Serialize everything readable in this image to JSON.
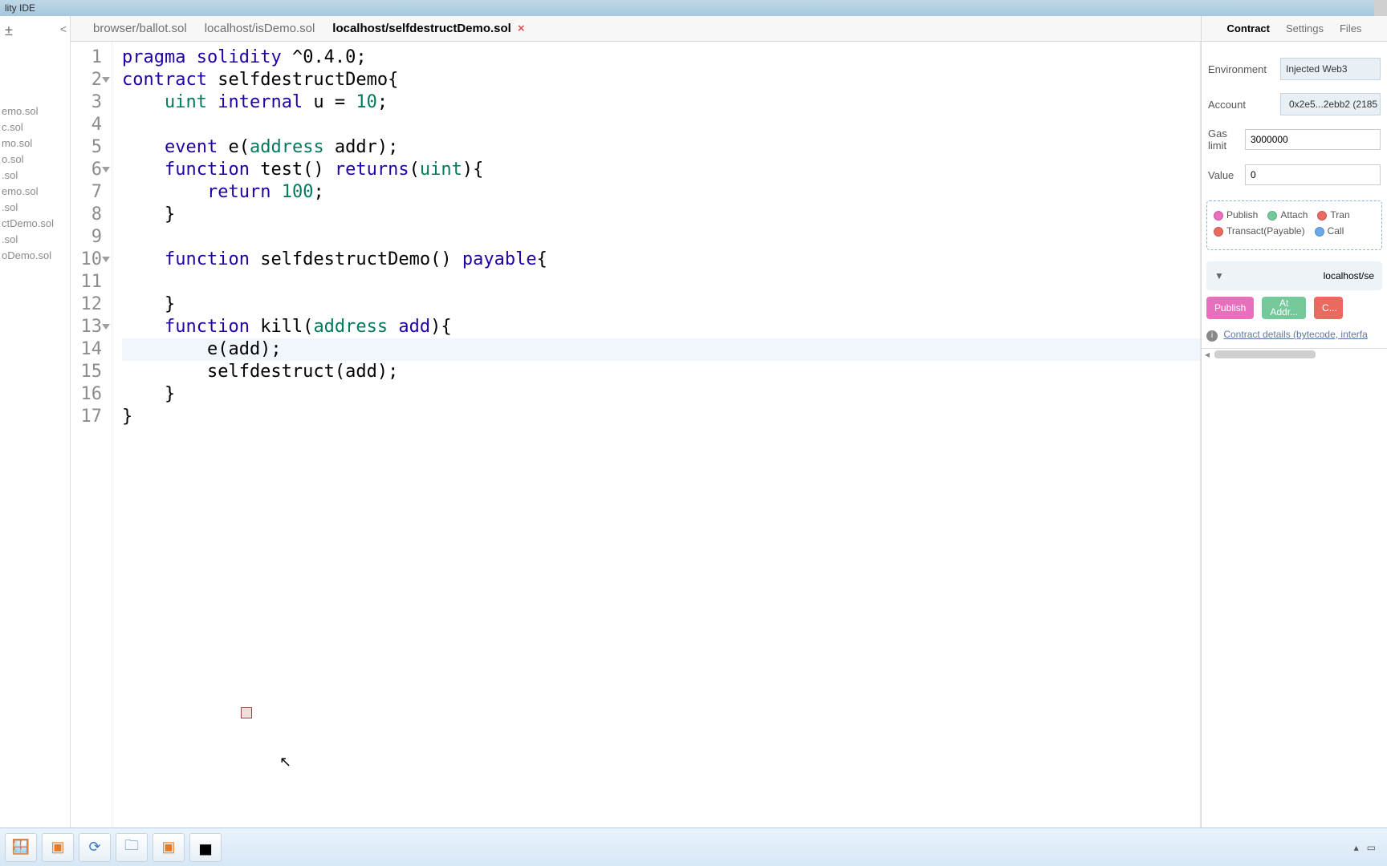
{
  "window": {
    "title_fragment": "lity IDE"
  },
  "sidebar": {
    "files": [
      "emo.sol",
      "c.sol",
      "mo.sol",
      "o.sol",
      ".sol",
      "",
      "emo.sol",
      ".sol",
      "ctDemo.sol",
      ".sol",
      "oDemo.sol"
    ]
  },
  "tabs": [
    {
      "label": "browser/ballot.sol",
      "active": false
    },
    {
      "label": "localhost/isDemo.sol",
      "active": false
    },
    {
      "label": "localhost/selfdestructDemo.sol",
      "active": true,
      "closable": true
    }
  ],
  "code": {
    "lines": [
      {
        "n": 1,
        "tokens": [
          [
            "kw",
            "pragma"
          ],
          [
            "",
            " "
          ],
          [
            "kw",
            "solidity"
          ],
          [
            "",
            " ^0.4.0;"
          ]
        ]
      },
      {
        "n": 2,
        "fold": true,
        "tokens": [
          [
            "kw",
            "contract"
          ],
          [
            "",
            " selfdestructDemo{"
          ]
        ]
      },
      {
        "n": 3,
        "tokens": [
          [
            "",
            "    "
          ],
          [
            "ty",
            "uint"
          ],
          [
            "",
            " "
          ],
          [
            "kw",
            "internal"
          ],
          [
            "",
            " u = "
          ],
          [
            "num",
            "10"
          ],
          [
            "",
            ";"
          ]
        ]
      },
      {
        "n": 4,
        "tokens": [
          [
            "",
            ""
          ]
        ]
      },
      {
        "n": 5,
        "tokens": [
          [
            "",
            "    "
          ],
          [
            "kw",
            "event"
          ],
          [
            "",
            " e("
          ],
          [
            "ty",
            "address"
          ],
          [
            "",
            " addr);"
          ]
        ]
      },
      {
        "n": 6,
        "fold": true,
        "tokens": [
          [
            "",
            "    "
          ],
          [
            "kw",
            "function"
          ],
          [
            "",
            " test() "
          ],
          [
            "kw",
            "returns"
          ],
          [
            "",
            "("
          ],
          [
            "ty",
            "uint"
          ],
          [
            "",
            "){"
          ]
        ]
      },
      {
        "n": 7,
        "tokens": [
          [
            "",
            "        "
          ],
          [
            "kw",
            "return"
          ],
          [
            "",
            " "
          ],
          [
            "num",
            "100"
          ],
          [
            "",
            ";"
          ]
        ]
      },
      {
        "n": 8,
        "tokens": [
          [
            "",
            "    }"
          ]
        ]
      },
      {
        "n": 9,
        "tokens": [
          [
            "",
            ""
          ]
        ]
      },
      {
        "n": 10,
        "fold": true,
        "tokens": [
          [
            "",
            "    "
          ],
          [
            "kw",
            "function"
          ],
          [
            "",
            " selfdestructDemo() "
          ],
          [
            "kw",
            "payable"
          ],
          [
            "",
            "{"
          ]
        ]
      },
      {
        "n": 11,
        "tokens": [
          [
            "",
            ""
          ]
        ]
      },
      {
        "n": 12,
        "tokens": [
          [
            "",
            "    }"
          ]
        ]
      },
      {
        "n": 13,
        "fold": true,
        "tokens": [
          [
            "",
            "    "
          ],
          [
            "kw",
            "function"
          ],
          [
            "",
            " kill("
          ],
          [
            "ty",
            "address"
          ],
          [
            "",
            " "
          ],
          [
            "id",
            "add"
          ],
          [
            "",
            "){"
          ]
        ]
      },
      {
        "n": 14,
        "hl": true,
        "tokens": [
          [
            "",
            "        e(add);"
          ]
        ]
      },
      {
        "n": 15,
        "tokens": [
          [
            "",
            "        selfdestruct(add);"
          ]
        ]
      },
      {
        "n": 16,
        "tokens": [
          [
            "",
            "    }"
          ]
        ]
      },
      {
        "n": 17,
        "tokens": [
          [
            "",
            "}"
          ]
        ]
      }
    ]
  },
  "right": {
    "tabs": [
      "Contract",
      "Settings",
      "Files"
    ],
    "environment": {
      "label": "Environment",
      "value": "Injected Web3"
    },
    "account": {
      "label": "Account",
      "value": "0x2e5...2ebb2 (2185"
    },
    "gaslimit": {
      "label": "Gas limit",
      "value": "3000000"
    },
    "value": {
      "label": "Value",
      "value": "0"
    },
    "legend": {
      "colors": {
        "publish": "#e86fbd",
        "attach": "#74c99b",
        "tran": "#ea6a5f",
        "transactPayable": "#ea6a5f",
        "call": "#6aa8e8"
      },
      "publish": "Publish",
      "attach": "Attach",
      "tran": "Tran",
      "transactPayable": "Transact(Payable)",
      "call": "Call"
    },
    "instanceLabel": "localhost/se",
    "buttons": {
      "publish": "Publish",
      "attach_line1": "At",
      "attach_line2": "Addr...",
      "create": "C..."
    },
    "detailsLink": "Contract details (bytecode, interfa"
  },
  "taskbar": {
    "buttons": [
      "start",
      "powerpoint",
      "refresh",
      "explorer",
      "ppt2",
      "cmd"
    ]
  }
}
